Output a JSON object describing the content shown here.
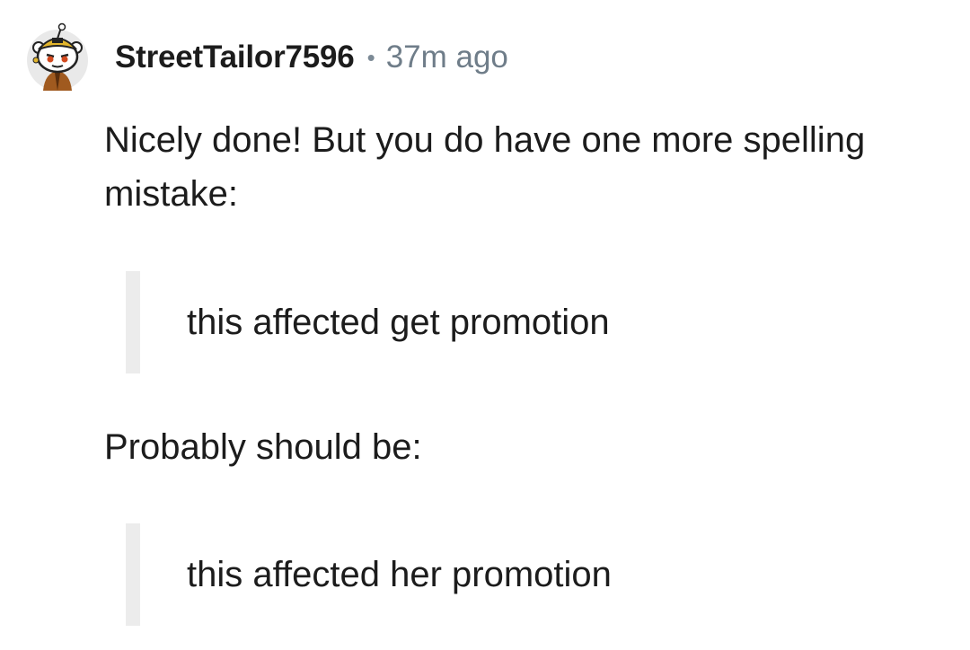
{
  "comment": {
    "author": "StreetTailor7596",
    "separator": "•",
    "timestamp": "37m ago",
    "avatar_icon": "snoo-avatar-icon",
    "paragraphs": [
      "Nicely done! But you do have one more spelling mistake:",
      "Probably should be:"
    ],
    "quotes": [
      "this affected get promotion",
      "this affected her promotion"
    ]
  },
  "colors": {
    "text": "#1c1c1c",
    "meta": "#6f7d89",
    "quote_bar": "#ececec",
    "background": "#ffffff"
  }
}
